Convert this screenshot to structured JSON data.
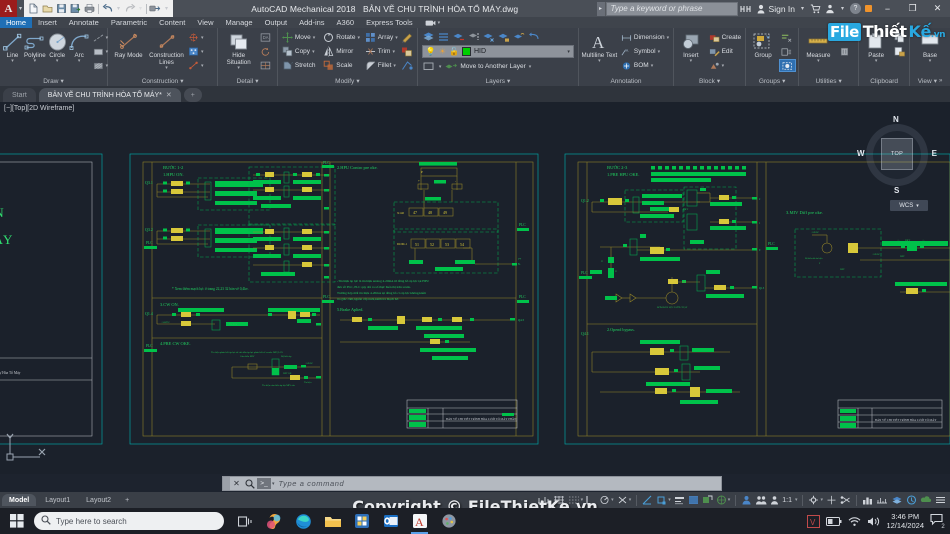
{
  "titlebar": {
    "app_logo": "autocad-a-logo",
    "app_title": "AutoCAD Mechanical 2018",
    "document_title": "BẢN VẼ CHU TRÌNH HÒA TỔ MÁY.dwg",
    "search_placeholder": "Type a keyword or phrase",
    "signin_label": "Sign In",
    "quick_access": [
      "new-icon",
      "open-icon",
      "save-icon",
      "saveas-icon",
      "plot-icon",
      "undo-icon",
      "redo-icon",
      "qat-customize-icon"
    ],
    "window_controls": [
      "minimize",
      "restore",
      "close"
    ]
  },
  "ribbon_tabs": [
    {
      "label": "Home",
      "active": true
    },
    {
      "label": "Insert",
      "active": false
    },
    {
      "label": "Annotate",
      "active": false
    },
    {
      "label": "Parametric",
      "active": false
    },
    {
      "label": "Content",
      "active": false
    },
    {
      "label": "View",
      "active": false
    },
    {
      "label": "Manage",
      "active": false
    },
    {
      "label": "Output",
      "active": false
    },
    {
      "label": "Add-ins",
      "active": false
    },
    {
      "label": "A360",
      "active": false
    },
    {
      "label": "Express Tools",
      "active": false
    }
  ],
  "ribbon_panels": {
    "draw": {
      "title": "Draw",
      "big": [
        {
          "label": "Line",
          "icon": "line-icon"
        },
        {
          "label": "Polyline",
          "icon": "polyline-icon"
        },
        {
          "label": "Circle",
          "icon": "circle-icon"
        },
        {
          "label": "Arc",
          "icon": "arc-icon"
        }
      ],
      "small": [
        "construction-line-icon",
        "rectangle-icon",
        "hatch-icon"
      ]
    },
    "construction": {
      "title": "Construction",
      "big": [
        {
          "label": "Ray Mode",
          "icon": "ray-mode-icon"
        },
        {
          "label": "Construction Lines",
          "icon": "construction-lines-icon"
        }
      ],
      "small": [
        "centerline-icon",
        "hole-pattern-icon",
        "construction-more-icon"
      ]
    },
    "detail": {
      "title": "Detail",
      "big": [
        {
          "label": "Hide Situation",
          "icon": "hide-situation-icon"
        }
      ],
      "small": [
        "detail-view-icon",
        "restore-situation-icon",
        "edit-situation-icon"
      ]
    },
    "modify": {
      "title": "Modify",
      "items": [
        {
          "label": "Move",
          "icon": "move-icon"
        },
        {
          "label": "Rotate",
          "icon": "rotate-icon"
        },
        {
          "label": "Array",
          "icon": "array-icon"
        },
        {
          "label": "Copy",
          "icon": "copy-icon"
        },
        {
          "label": "Mirror",
          "icon": "mirror-icon"
        },
        {
          "label": "Trim",
          "icon": "trim-icon"
        },
        {
          "label": "Stretch",
          "icon": "stretch-icon"
        },
        {
          "label": "Scale",
          "icon": "scale-icon"
        },
        {
          "label": "Fillet",
          "icon": "fillet-icon"
        }
      ],
      "extra_icons": [
        "power-edit-icon",
        "power-copy-icon",
        "power-snap-icon"
      ]
    },
    "layers": {
      "title": "Layers",
      "current_layer": "HID",
      "layer_color": "#00d000",
      "move_to_layer_label": "Move to Another Layer",
      "tool_icons": [
        "layer-properties-icon",
        "layer-match-icon",
        "layer-off-icon",
        "layer-isolate-icon",
        "layer-freeze-icon",
        "layer-lock-icon",
        "layer-unlock-icon",
        "layer-previous-icon"
      ],
      "state_icons": [
        "lightbulb-on-icon",
        "sun-icon",
        "unlock-icon"
      ]
    },
    "annotation": {
      "title": "Annotation",
      "big": [
        {
          "label": "Multiline Text",
          "icon": "multiline-text-icon"
        }
      ],
      "items": [
        {
          "label": "Dimension",
          "icon": "dimension-icon"
        },
        {
          "label": "Symbol",
          "icon": "symbol-icon"
        },
        {
          "label": "BOM",
          "icon": "bom-icon"
        }
      ]
    },
    "block": {
      "title": "Block",
      "big": [
        {
          "label": "Insert",
          "icon": "insert-block-icon"
        }
      ],
      "items": [
        {
          "label": "Create",
          "icon": "create-block-icon"
        },
        {
          "label": "Edit",
          "icon": "edit-block-icon"
        },
        {
          "label": "",
          "icon": "block-attribute-icon"
        }
      ]
    },
    "groups": {
      "title": "Groups",
      "big": [
        {
          "label": "Group",
          "icon": "group-icon"
        }
      ],
      "small": [
        "ungroup-icon",
        "group-edit-icon",
        "group-selection-icon"
      ]
    },
    "utilities": {
      "title": "Utilities",
      "big": [
        {
          "label": "Measure",
          "icon": "measure-icon"
        }
      ],
      "small": [
        "quick-select-icon",
        "delete-duplicate-icon"
      ]
    },
    "clipboard": {
      "title": "Clipboard",
      "big": [
        {
          "label": "Paste",
          "icon": "paste-icon"
        }
      ],
      "small": [
        "copy-clip-icon",
        "paste-special-icon"
      ]
    },
    "view": {
      "title": "View",
      "big": [
        {
          "label": "Base",
          "icon": "base-view-icon"
        }
      ]
    }
  },
  "document_tabs": [
    {
      "label": "Start",
      "active": false,
      "closable": false
    },
    {
      "label": "BẢN VẼ CHU TRÌNH HÒA TỔ MÁY*",
      "active": true,
      "closable": true
    },
    {
      "label": "+",
      "active": false,
      "closable": false
    }
  ],
  "viewport": {
    "label": "[−][Top][2D Wireframe]",
    "viewcube": {
      "top": "TOP",
      "north": "N",
      "south": "S",
      "east": "E",
      "west": "W"
    },
    "wcs_label": "WCS"
  },
  "command_line": {
    "placeholder": "Type a command",
    "prompt_glyph": ">_",
    "icons": [
      "close-command-icon",
      "recent-command-icon"
    ]
  },
  "layout_tabs": [
    {
      "label": "Model",
      "active": true
    },
    {
      "label": "Layout1",
      "active": false
    },
    {
      "label": "Layout2",
      "active": false
    },
    {
      "label": "+",
      "active": false
    }
  ],
  "status_bar": {
    "scale_label": "1:1",
    "icons": [
      "grid-mode-icon",
      "snap-mode-icon",
      "ortho-mode-icon",
      "polar-tracking-icon",
      "isometric-draft-icon",
      "object-snap-tracking-icon",
      "object-snap-icon",
      "lineweight-icon",
      "transparency-icon",
      "selection-cycling-icon",
      "annotation-monitor-icon",
      "workspace-gear-icon",
      "customization-plus-icon",
      "isolate-objects-icon",
      "hardware-accel-icon",
      "clean-screen-icon",
      "annotation-visibility-icon",
      "autoscale-icon",
      "menu-icon"
    ]
  },
  "taskbar": {
    "start_icon": "windows-start-icon",
    "search_placeholder": "Type here to search",
    "search_icon": "search-icon",
    "apps": [
      {
        "name": "task-view-icon",
        "active": false
      },
      {
        "name": "copilot-icon",
        "active": false
      },
      {
        "name": "edge-browser-icon",
        "active": false
      },
      {
        "name": "file-explorer-icon",
        "active": false
      },
      {
        "name": "microsoft-store-icon",
        "active": false
      },
      {
        "name": "outlook-icon",
        "active": false
      },
      {
        "name": "autocad-icon",
        "active": true
      },
      {
        "name": "paint-icon",
        "active": false
      }
    ],
    "tray": [
      "unikey-icon",
      "battery-icon",
      "wifi-icon",
      "volume-icon"
    ],
    "clock_time": "3:46 PM",
    "clock_date": "12/14/2024",
    "notification_count": "2"
  },
  "watermark": {
    "logo_file": "File",
    "logo_thiet": "Thiết",
    "logo_ke": "Kế",
    "logo_vn": ".vn",
    "copyright": "Copyright © FileThietKe.vn"
  },
  "drawing": {
    "left_sheet_title_lines": [
      "IỀN",
      "MÁY"
    ],
    "left_sheet_footer": "hủ Trình Tự Hòa Tổ Máy",
    "sheet_1": {
      "step_header": "BƯỚC 1-2",
      "sections": [
        {
          "id": "1",
          "label": "1.HPU ON.",
          "tag_left": "Q3.1"
        },
        {
          "id": "1b",
          "label": "",
          "tag_left": "Q3.2"
        },
        {
          "id": "3",
          "label": "3.CW ON.",
          "tag_left": "Q1.4"
        },
        {
          "id": "4",
          "label": "4.PRE CW OKE.",
          "tag_left": ""
        }
      ],
      "note": "* Xem thêm mạch lực ở trang 22,23  32 bản vẽ 0,4kv.",
      "plc_labels": [
        "PLC",
        "PLC",
        "PLC"
      ],
      "title_block": "BẢN VẼ CHI TIẾT TRÌNH HÒA LƯỚI TỔ MÁY  PHẦN"
    },
    "sheet_2": {
      "sections": [
        {
          "id": "2",
          "label": "2.HPU Contro pre oke."
        },
        {
          "id": "5",
          "label": "5.Brake Aplied."
        }
      ],
      "terminal_row_1": {
        "tag": "X140",
        "cells": [
          "47",
          "48",
          "49"
        ]
      },
      "terminal_row_2": {
        "tag": "DOM-1",
        "cells": [
          "51",
          "52",
          "53",
          "54"
        ]
      },
      "note_lines": [
        "-Tín hiệu áp lực là tín hiệu analog 4-20mA từ đồng hồ áp lực tại HPU",
        "đưa về PLC, PLC quy đổi ra số thực hiển thị trên scada.",
        "Trường hợp mất tín hiệu 4-20mA tại đồng hồ có áp lực không,kiểm",
        "tra giắc cắm,nguồn cấp nuôi,kiểm tra mạch hở."
      ],
      "plc_labels": [
        "PLC",
        "PLC"
      ]
    },
    "sheet_3": {
      "step_header": "BƯỚC 2-3",
      "sections": [
        {
          "id": "1",
          "label": "1.PRE HPU OKE.",
          "tag_left": "Q1.2"
        },
        {
          "id": "2",
          "label": "2.Opend bypass.",
          "tag_left": "Q4.1"
        }
      ],
      "plc_labels": [
        "PLC",
        "PLC"
      ],
      "title_block": "BẢN VẼ CHI TIẾT TRÌNH HÒA LƯỚI TỔ MÁY"
    },
    "sheet_4": {
      "sections": [
        {
          "id": "3",
          "label": "3.MIV  Diff pre oke."
        }
      ]
    }
  }
}
